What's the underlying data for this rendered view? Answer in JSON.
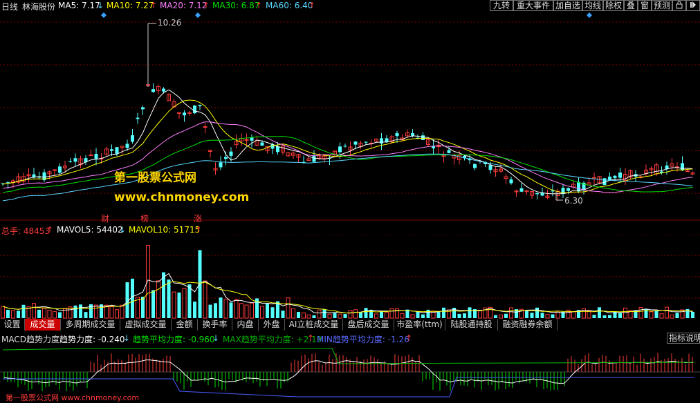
{
  "colors": {
    "up": "#ff3b3b",
    "down": "#54ffff",
    "ma5": "#ffffff",
    "ma10": "#ffff00",
    "ma20": "#ff80ff",
    "ma30": "#00e000",
    "ma60": "#5ad7ff",
    "grid": "#800000"
  },
  "header": {
    "period": "日线",
    "stock": "林海股份",
    "ma5_label": "MA5: 7.17",
    "ma5_arrow": "↓",
    "ma10_label": "MA10: 7.27",
    "ma10_arrow": "↑",
    "ma20_label": "MA20: 7.12",
    "ma20_arrow": "↑",
    "ma30_label": "MA30: 6.87",
    "ma30_arrow": "↑",
    "ma60_label": "MA60: 6.40",
    "ma60_arrow": "↑"
  },
  "toolbar": {
    "items": [
      "九转",
      "重大事件",
      "加自选",
      "均线",
      "除权",
      "叠",
      "窗",
      "预测"
    ],
    "lock_icon": "lock-icon",
    "right_icon": "arrow-right-icon"
  },
  "price_chart": {
    "high_label": "10.26",
    "low_label": "6.30",
    "event_tags": [
      "财",
      "榜",
      "涨"
    ],
    "watermark_cn": "第一股票公式网",
    "watermark_url": "www.chnmoney.com"
  },
  "volume": {
    "total_label": "总手: 48453",
    "total_arrow": "↑",
    "mavol5_label": "MAVOL5: 54402",
    "mavol5_arrow": "↓",
    "mavol10_label": "MAVOL10: 51715",
    "mavol10_arrow": "↑"
  },
  "tabs": {
    "items": [
      "设置",
      "成交量",
      "多周期成交量",
      "虚拟成交量",
      "金额",
      "换手率",
      "内盘",
      "外盘",
      "AI立桩成交量",
      "盘后成交量",
      "市盈率(ttm)",
      "陆股通持股",
      "融资融券余额"
    ],
    "active": "成交量"
  },
  "macd": {
    "title": "MACD趋势力度",
    "trend_label": "趋势力度: -0.240",
    "trend_arrow": "↓",
    "avg_label": "趋势平均力度: -0.960",
    "avg_arrow": "↓",
    "max_label": "MAX趋势平均力度: +2.19",
    "max_arrow": "↑",
    "min_label": "MIN趋势平均力度: -1.26",
    "min_arrow": "↑",
    "help_button": "指标说明"
  },
  "footer_watermark": "第一股票公式网 www.chnmoney.com"
}
